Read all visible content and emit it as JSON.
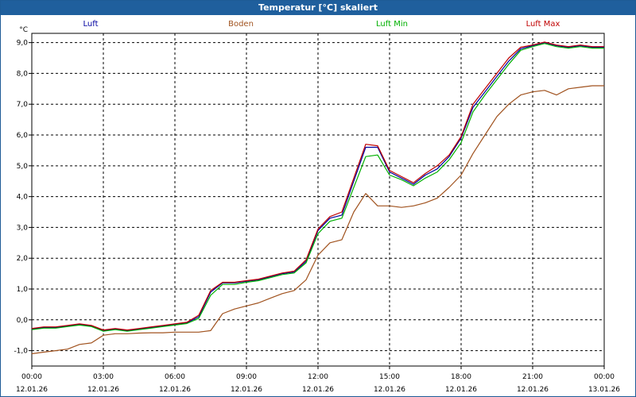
{
  "window": {
    "title": "Temperatur [°C] skaliert"
  },
  "chart_data": {
    "type": "line",
    "unit": "°C",
    "ylim": [
      -1.5,
      9.3
    ],
    "yticks": [
      "9,0",
      "8,0",
      "7,0",
      "6,0",
      "5,0",
      "4,0",
      "3,0",
      "2,0",
      "1,0",
      "0,0",
      "-1,0"
    ],
    "yticks_values": [
      9,
      8,
      7,
      6,
      5,
      4,
      3,
      2,
      1,
      0,
      -1
    ],
    "x_hours": [
      0,
      3,
      6,
      9,
      12,
      15,
      18,
      21,
      24
    ],
    "xtick_times": [
      "00:00",
      "03:00",
      "06:00",
      "09:00",
      "12:00",
      "15:00",
      "18:00",
      "21:00",
      "00:00"
    ],
    "xtick_dates": [
      "12.01.26",
      "12.01.26",
      "12.01.26",
      "12.01.26",
      "12.01.26",
      "12.01.26",
      "12.01.26",
      "12.01.26",
      "13.01.26"
    ],
    "grid": true,
    "legend_position": "top",
    "series": [
      {
        "name": "Luft",
        "color": "#0000a0",
        "points": [
          [
            0,
            -0.3
          ],
          [
            0.5,
            -0.25
          ],
          [
            1,
            -0.25
          ],
          [
            1.5,
            -0.2
          ],
          [
            2,
            -0.15
          ],
          [
            2.5,
            -0.2
          ],
          [
            3,
            -0.35
          ],
          [
            3.5,
            -0.3
          ],
          [
            4,
            -0.35
          ],
          [
            4.5,
            -0.3
          ],
          [
            5,
            -0.25
          ],
          [
            5.5,
            -0.2
          ],
          [
            6,
            -0.15
          ],
          [
            6.5,
            -0.1
          ],
          [
            7,
            0.1
          ],
          [
            7.5,
            0.9
          ],
          [
            8,
            1.2
          ],
          [
            8.5,
            1.2
          ],
          [
            9,
            1.25
          ],
          [
            9.5,
            1.3
          ],
          [
            10,
            1.4
          ],
          [
            10.5,
            1.5
          ],
          [
            11,
            1.55
          ],
          [
            11.5,
            1.9
          ],
          [
            12,
            2.9
          ],
          [
            12.5,
            3.3
          ],
          [
            13,
            3.4
          ],
          [
            13.5,
            4.5
          ],
          [
            14,
            5.6
          ],
          [
            14.5,
            5.6
          ],
          [
            15,
            4.8
          ],
          [
            15.5,
            4.6
          ],
          [
            16,
            4.4
          ],
          [
            16.5,
            4.7
          ],
          [
            17,
            4.9
          ],
          [
            17.5,
            5.3
          ],
          [
            18,
            5.9
          ],
          [
            18.5,
            6.9
          ],
          [
            19,
            7.4
          ],
          [
            19.5,
            7.9
          ],
          [
            20,
            8.4
          ],
          [
            20.5,
            8.8
          ],
          [
            21,
            8.9
          ],
          [
            21.5,
            9.0
          ],
          [
            22,
            8.9
          ],
          [
            22.5,
            8.85
          ],
          [
            23,
            8.9
          ],
          [
            23.5,
            8.85
          ],
          [
            24,
            8.85
          ]
        ]
      },
      {
        "name": "Boden",
        "color": "#a0521e",
        "points": [
          [
            0,
            -1.1
          ],
          [
            0.5,
            -1.05
          ],
          [
            1,
            -1.0
          ],
          [
            1.5,
            -0.95
          ],
          [
            2,
            -0.8
          ],
          [
            2.5,
            -0.75
          ],
          [
            3,
            -0.5
          ],
          [
            3.5,
            -0.45
          ],
          [
            4,
            -0.45
          ],
          [
            4.5,
            -0.43
          ],
          [
            5,
            -0.42
          ],
          [
            5.5,
            -0.42
          ],
          [
            6,
            -0.4
          ],
          [
            6.5,
            -0.4
          ],
          [
            7,
            -0.4
          ],
          [
            7.5,
            -0.35
          ],
          [
            8,
            0.2
          ],
          [
            8.5,
            0.35
          ],
          [
            9,
            0.45
          ],
          [
            9.5,
            0.55
          ],
          [
            10,
            0.7
          ],
          [
            10.5,
            0.85
          ],
          [
            11,
            0.95
          ],
          [
            11.5,
            1.3
          ],
          [
            12,
            2.1
          ],
          [
            12.5,
            2.5
          ],
          [
            13,
            2.6
          ],
          [
            13.5,
            3.5
          ],
          [
            14,
            4.1
          ],
          [
            14.5,
            3.7
          ],
          [
            15,
            3.7
          ],
          [
            15.5,
            3.65
          ],
          [
            16,
            3.7
          ],
          [
            16.5,
            3.8
          ],
          [
            17,
            3.95
          ],
          [
            17.5,
            4.3
          ],
          [
            18,
            4.7
          ],
          [
            18.5,
            5.4
          ],
          [
            19,
            6.0
          ],
          [
            19.5,
            6.6
          ],
          [
            20,
            7.0
          ],
          [
            20.5,
            7.3
          ],
          [
            21,
            7.4
          ],
          [
            21.5,
            7.45
          ],
          [
            22,
            7.3
          ],
          [
            22.5,
            7.5
          ],
          [
            23,
            7.55
          ],
          [
            23.5,
            7.6
          ],
          [
            24,
            7.6
          ]
        ]
      },
      {
        "name": "Luft Min",
        "color": "#00b000",
        "points": [
          [
            0,
            -0.32
          ],
          [
            0.5,
            -0.27
          ],
          [
            1,
            -0.27
          ],
          [
            1.5,
            -0.22
          ],
          [
            2,
            -0.17
          ],
          [
            2.5,
            -0.22
          ],
          [
            3,
            -0.37
          ],
          [
            3.5,
            -0.32
          ],
          [
            4,
            -0.37
          ],
          [
            4.5,
            -0.32
          ],
          [
            5,
            -0.27
          ],
          [
            5.5,
            -0.22
          ],
          [
            6,
            -0.17
          ],
          [
            6.5,
            -0.12
          ],
          [
            7,
            0.05
          ],
          [
            7.5,
            0.8
          ],
          [
            8,
            1.15
          ],
          [
            8.5,
            1.15
          ],
          [
            9,
            1.22
          ],
          [
            9.5,
            1.27
          ],
          [
            10,
            1.37
          ],
          [
            10.5,
            1.47
          ],
          [
            11,
            1.52
          ],
          [
            11.5,
            1.85
          ],
          [
            12,
            2.8
          ],
          [
            12.5,
            3.2
          ],
          [
            13,
            3.3
          ],
          [
            13.5,
            4.3
          ],
          [
            14,
            5.3
          ],
          [
            14.5,
            5.35
          ],
          [
            15,
            4.7
          ],
          [
            15.5,
            4.55
          ],
          [
            16,
            4.35
          ],
          [
            16.5,
            4.6
          ],
          [
            17,
            4.8
          ],
          [
            17.5,
            5.2
          ],
          [
            18,
            5.75
          ],
          [
            18.5,
            6.75
          ],
          [
            19,
            7.3
          ],
          [
            19.5,
            7.8
          ],
          [
            20,
            8.3
          ],
          [
            20.5,
            8.75
          ],
          [
            21,
            8.87
          ],
          [
            21.5,
            8.97
          ],
          [
            22,
            8.87
          ],
          [
            22.5,
            8.82
          ],
          [
            23,
            8.87
          ],
          [
            23.5,
            8.82
          ],
          [
            24,
            8.82
          ]
        ]
      },
      {
        "name": "Luft Max",
        "color": "#c00000",
        "points": [
          [
            0,
            -0.28
          ],
          [
            0.5,
            -0.23
          ],
          [
            1,
            -0.23
          ],
          [
            1.5,
            -0.18
          ],
          [
            2,
            -0.13
          ],
          [
            2.5,
            -0.18
          ],
          [
            3,
            -0.33
          ],
          [
            3.5,
            -0.28
          ],
          [
            4,
            -0.33
          ],
          [
            4.5,
            -0.28
          ],
          [
            5,
            -0.23
          ],
          [
            5.5,
            -0.18
          ],
          [
            6,
            -0.13
          ],
          [
            6.5,
            -0.08
          ],
          [
            7,
            0.15
          ],
          [
            7.5,
            0.95
          ],
          [
            8,
            1.22
          ],
          [
            8.5,
            1.22
          ],
          [
            9,
            1.27
          ],
          [
            9.5,
            1.32
          ],
          [
            10,
            1.42
          ],
          [
            10.5,
            1.52
          ],
          [
            11,
            1.58
          ],
          [
            11.5,
            1.95
          ],
          [
            12,
            2.95
          ],
          [
            12.5,
            3.35
          ],
          [
            13,
            3.5
          ],
          [
            13.5,
            4.6
          ],
          [
            14,
            5.7
          ],
          [
            14.5,
            5.65
          ],
          [
            15,
            4.85
          ],
          [
            15.5,
            4.65
          ],
          [
            16,
            4.45
          ],
          [
            16.5,
            4.75
          ],
          [
            17,
            5.0
          ],
          [
            17.5,
            5.35
          ],
          [
            18,
            5.95
          ],
          [
            18.5,
            7.0
          ],
          [
            19,
            7.5
          ],
          [
            19.5,
            8.0
          ],
          [
            20,
            8.5
          ],
          [
            20.5,
            8.85
          ],
          [
            21,
            8.92
          ],
          [
            21.5,
            9.02
          ],
          [
            22,
            8.92
          ],
          [
            22.5,
            8.87
          ],
          [
            23,
            8.92
          ],
          [
            23.5,
            8.87
          ],
          [
            24,
            8.87
          ]
        ]
      }
    ]
  }
}
